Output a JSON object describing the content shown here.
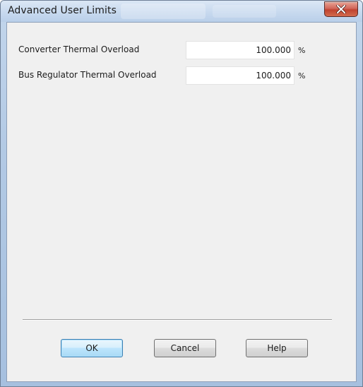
{
  "window": {
    "title": "Advanced User Limits"
  },
  "fields": [
    {
      "label": "Converter Thermal Overload",
      "value": "100.000",
      "unit": "%"
    },
    {
      "label": "Bus Regulator Thermal Overload",
      "value": "100.000",
      "unit": "%"
    }
  ],
  "buttons": {
    "ok_label": "OK",
    "cancel_label": "Cancel",
    "help_label": "Help"
  },
  "icons": {
    "close": "close-icon"
  },
  "colors": {
    "close_button": "#c0432f",
    "default_button_border": "#3c7fb1",
    "client_background": "#f0f0f0"
  }
}
